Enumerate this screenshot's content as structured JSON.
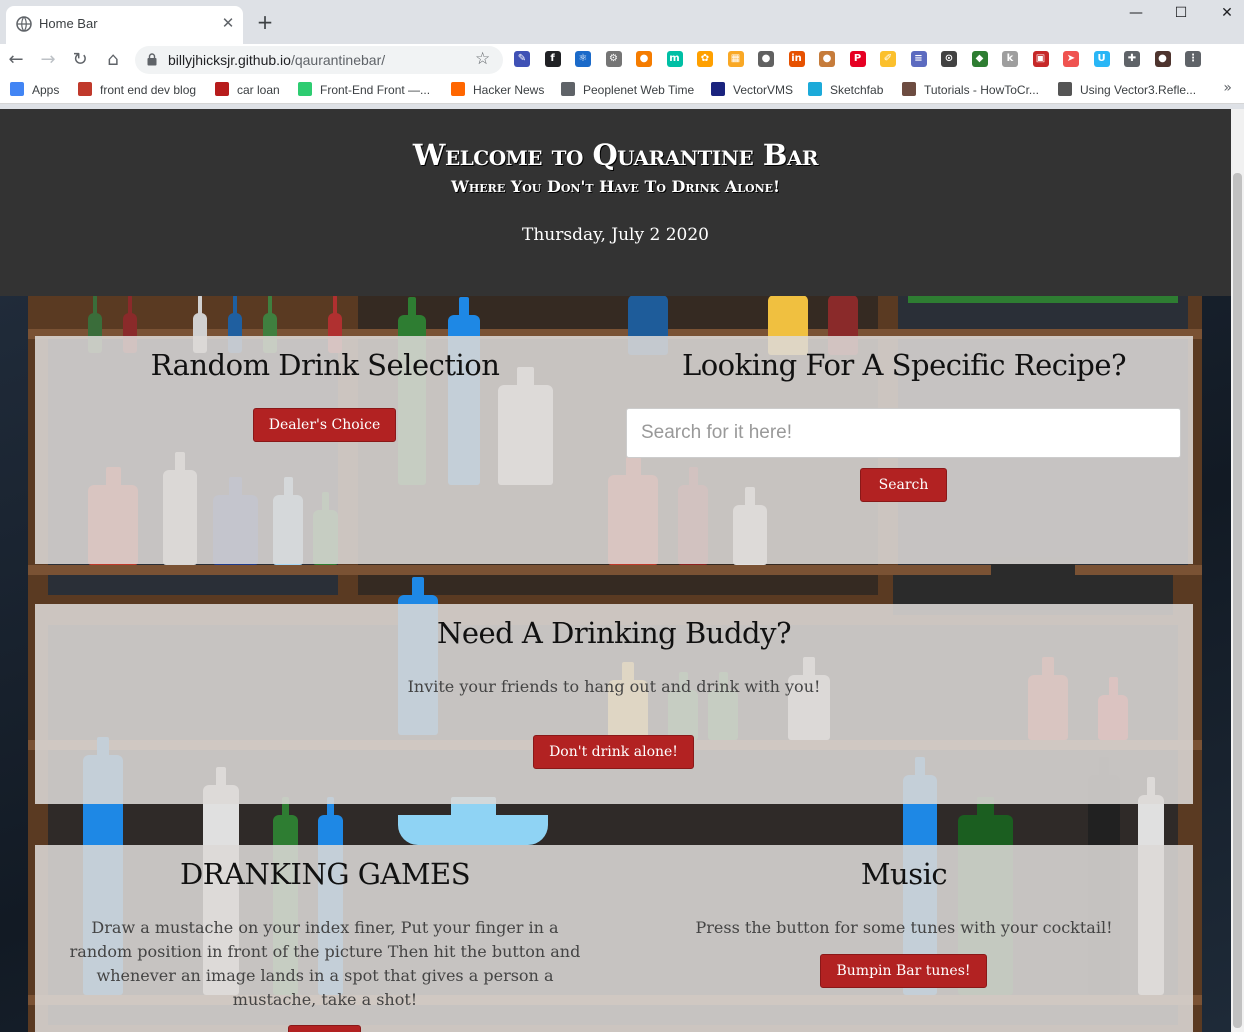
{
  "browser": {
    "tab_title": "Home Bar",
    "tab_close": "✕",
    "new_tab": "+",
    "window_controls": {
      "minimize": "—",
      "maximize": "☐",
      "close": "✕"
    },
    "url_domain": "billyjhicksjr.github.io",
    "url_path": "/qaurantinebar/",
    "bookmarks": [
      {
        "label": "Apps",
        "icon": "apps-grid-icon",
        "color": "#4285f4"
      },
      {
        "label": "front end dev blog",
        "icon": "blog-icon",
        "color": "#c0392b"
      },
      {
        "label": "car loan",
        "icon": "car-loan-icon",
        "color": "#b71c1c"
      },
      {
        "label": "Front-End Front —...",
        "icon": "frontend-icon",
        "color": "#2ecc71"
      },
      {
        "label": "Hacker News",
        "icon": "hacker-news-icon",
        "color": "#ff6600"
      },
      {
        "label": "Peoplenet Web Time",
        "icon": "globe-icon",
        "color": "#5f6368"
      },
      {
        "label": "VectorVMS",
        "icon": "vectorvms-icon",
        "color": "#1a237e"
      },
      {
        "label": "Sketchfab",
        "icon": "sketchfab-icon",
        "color": "#1caad9"
      },
      {
        "label": "Tutorials - HowToCr...",
        "icon": "tutorials-icon",
        "color": "#6d4c41"
      },
      {
        "label": "Using Vector3.Refle...",
        "icon": "unity-icon",
        "color": "#555555"
      }
    ],
    "bookmarks_more": "»",
    "extensions": [
      {
        "icon": "eyedropper-icon",
        "color": "#3f51b5",
        "glyph": "✎"
      },
      {
        "icon": "font-icon",
        "color": "#202124",
        "glyph": "f"
      },
      {
        "icon": "react-icon",
        "color": "#1b6ac9",
        "glyph": "⚛"
      },
      {
        "icon": "gear-ext-icon",
        "color": "#757575",
        "glyph": "⚙"
      },
      {
        "icon": "chat-ext-icon",
        "color": "#f57c00",
        "glyph": "●"
      },
      {
        "icon": "m-ext-icon",
        "color": "#00bfa5",
        "glyph": "m"
      },
      {
        "icon": "flower-ext-icon",
        "color": "#ffa000",
        "glyph": "✿"
      },
      {
        "icon": "grid-ext-icon",
        "color": "#f9a825",
        "glyph": "▦"
      },
      {
        "icon": "dot-ext-icon",
        "color": "#616161",
        "glyph": "●"
      },
      {
        "icon": "in-ext-icon",
        "color": "#e65100",
        "glyph": "in"
      },
      {
        "icon": "cookie-ext-icon",
        "color": "#c67c3b",
        "glyph": "●"
      },
      {
        "icon": "pinterest-icon",
        "color": "#e60023",
        "glyph": "P"
      },
      {
        "icon": "pencil-ext-icon",
        "color": "#fbc02d",
        "glyph": "✐"
      },
      {
        "icon": "stripes-ext-icon",
        "color": "#5c6bc0",
        "glyph": "≡"
      },
      {
        "icon": "code-ext-icon",
        "color": "#424242",
        "glyph": "⊙"
      },
      {
        "icon": "shield-ext-icon",
        "color": "#2e7d32",
        "glyph": "◆"
      },
      {
        "icon": "k-ext-icon",
        "color": "#9e9e9e",
        "glyph": "k"
      },
      {
        "icon": "box-ext-icon",
        "color": "#c62828",
        "glyph": "▣"
      },
      {
        "icon": "arrow-ext-icon",
        "color": "#ef5350",
        "glyph": "➤"
      },
      {
        "icon": "cup-ext-icon",
        "color": "#29b6f6",
        "glyph": "U"
      },
      {
        "icon": "puzzle-icon",
        "color": "#5f6368",
        "glyph": "✚"
      },
      {
        "icon": "avatar-icon",
        "color": "#4e342e",
        "glyph": "●"
      },
      {
        "icon": "menu-dots-icon",
        "color": "#5f6368",
        "glyph": "⋮"
      }
    ]
  },
  "page": {
    "title": "Welcome to Quarantine Bar",
    "tagline": "Where You Don't Have To Drink Alone!",
    "date": "Thursday, July 2 2020",
    "random": {
      "heading": "Random Drink Selection",
      "button": "Dealer's Choice"
    },
    "search": {
      "heading": "Looking For A Specific Recipe?",
      "placeholder": "Search for it here!",
      "button": "Search"
    },
    "buddy": {
      "heading": "Need A Drinking Buddy?",
      "text": "Invite your friends to hang out and drink with you!",
      "button": "Don't drink alone!"
    },
    "games": {
      "heading": "DRANKING GAMES",
      "text": "Draw a mustache on your index finer, Put your finger in a random position in front of the picture Then hit the button and whenever an image lands in a spot that gives a person a mustache, take a shot!"
    },
    "music": {
      "heading": "Music",
      "text": "Press the button for some tunes with your cocktail!",
      "button": "Bumpin Bar tunes!"
    },
    "colors": {
      "header_bg": "#333333",
      "button_red": "#b22222",
      "card_bg": "#dcd8d6"
    }
  }
}
